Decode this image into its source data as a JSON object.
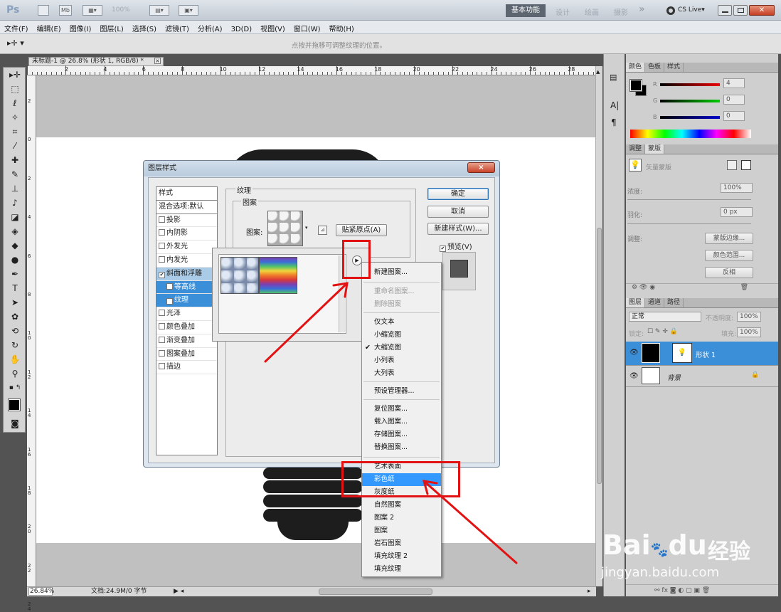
{
  "titlebar": {
    "logo": "Ps",
    "btn_br": "",
    "btn_mb": "Mb",
    "zoom": "100%",
    "workspaces": [
      "基本功能",
      "设计",
      "绘画",
      "摄影"
    ],
    "more": "»",
    "cslive": "CS Live",
    "cslive_arrow": "▾"
  },
  "menu": [
    "文件(F)",
    "编辑(E)",
    "图像(I)",
    "图层(L)",
    "选择(S)",
    "滤镜(T)",
    "分析(A)",
    "3D(D)",
    "视图(V)",
    "窗口(W)",
    "帮助(H)"
  ],
  "options": {
    "hint": "点按并拖移可调整纹理的位置。"
  },
  "document": {
    "tab_title": "未标题-1 @ 26.8% (形状 1, RGB/8) *",
    "tab_close": "×",
    "ruler_h": [
      "2",
      "4",
      "6",
      "8",
      "10",
      "12",
      "14",
      "16",
      "18",
      "20",
      "22",
      "24",
      "26",
      "28"
    ],
    "ruler_v": [
      "2",
      "0",
      "2",
      "4",
      "6",
      "8",
      "1\n0",
      "1\n2",
      "1\n4",
      "1\n6",
      "1\n8",
      "2\n0",
      "2\n2",
      "2\n4"
    ],
    "status_zoom": "26.84%",
    "status_doc": "文档:24.9M/0 字节"
  },
  "dialog": {
    "title": "图层样式",
    "close": "×",
    "styles_header": "样式",
    "blend_default": "混合选项:默认",
    "style_items": [
      {
        "label": "投影",
        "checked": false
      },
      {
        "label": "内阴影",
        "checked": false
      },
      {
        "label": "外发光",
        "checked": false
      },
      {
        "label": "内发光",
        "checked": false
      },
      {
        "label": "斜面和浮雕",
        "checked": true
      },
      {
        "label": "等高线",
        "checked": false
      },
      {
        "label": "纹理",
        "checked": true
      },
      {
        "label": "光泽",
        "checked": false
      },
      {
        "label": "颜色叠加",
        "checked": false
      },
      {
        "label": "渐变叠加",
        "checked": false
      },
      {
        "label": "图案叠加",
        "checked": false
      },
      {
        "label": "描边",
        "checked": false
      }
    ],
    "group_texture": "纹理",
    "group_pattern": "图案",
    "pattern_label": "图案:",
    "snap_button": "贴紧原点(A)",
    "ok": "确定",
    "cancel": "取消",
    "new_style": "新建样式(W)...",
    "preview": "预览(V)",
    "preview_checked": true
  },
  "context_menu": {
    "items": [
      {
        "label": "新建图案...",
        "disabled": false
      },
      {
        "label": "重命名图案...",
        "disabled": true
      },
      {
        "label": "删除图案",
        "disabled": true
      },
      {
        "label": "仅文本",
        "disabled": false
      },
      {
        "label": "小缩览图",
        "disabled": false
      },
      {
        "label": "大缩览图",
        "disabled": false,
        "checked": true
      },
      {
        "label": "小列表",
        "disabled": false
      },
      {
        "label": "大列表",
        "disabled": false
      },
      {
        "label": "预设管理器...",
        "disabled": false
      },
      {
        "label": "复位图案...",
        "disabled": false
      },
      {
        "label": "载入图案...",
        "disabled": false
      },
      {
        "label": "存储图案...",
        "disabled": false
      },
      {
        "label": "替换图案...",
        "disabled": false
      },
      {
        "label": "艺术表面",
        "disabled": false
      },
      {
        "label": "彩色纸",
        "disabled": false,
        "highlighted": true
      },
      {
        "label": "灰度纸",
        "disabled": false
      },
      {
        "label": "自然图案",
        "disabled": false
      },
      {
        "label": "图案 2",
        "disabled": false
      },
      {
        "label": "图案",
        "disabled": false
      },
      {
        "label": "岩石图案",
        "disabled": false
      },
      {
        "label": "填充纹理 2",
        "disabled": false
      },
      {
        "label": "填充纹理",
        "disabled": false
      }
    ]
  },
  "panels": {
    "color_tabs": [
      "颜色",
      "色板",
      "样式"
    ],
    "r_label": "R",
    "g_label": "G",
    "b_label": "B",
    "r_value": "4",
    "g_value": "0",
    "b_value": "0",
    "adjust_tabs": [
      "调整",
      "蒙版"
    ],
    "mask_title": "矢量蒙版",
    "density_label": "浓度:",
    "density_value": "100%",
    "feather_label": "羽化:",
    "feather_value": "0 px",
    "refine_label": "调整:",
    "mask_edge": "蒙版边缘...",
    "color_range": "颜色范围...",
    "invert": "反相",
    "layer_tabs": [
      "图层",
      "通道",
      "路径"
    ],
    "blend_mode": "正常",
    "opacity_label": "不透明度:",
    "opacity_value": "100%",
    "lock_label": "锁定:",
    "fill_label": "填充:",
    "fill_value": "100%",
    "layers": [
      {
        "name": "形状 1",
        "selected": true
      },
      {
        "name": "背景",
        "selected": false
      }
    ],
    "dock_text_a": "A|",
    "dock_para": "¶"
  },
  "watermark": {
    "brand": "Bai",
    "brand2": "du",
    "cn": "经验",
    "url": "jingyan.baidu.com"
  },
  "colors": {
    "highlight": "#3399ff",
    "annotation_red": "#e31212",
    "layer_selected": "#3b8fd9"
  }
}
